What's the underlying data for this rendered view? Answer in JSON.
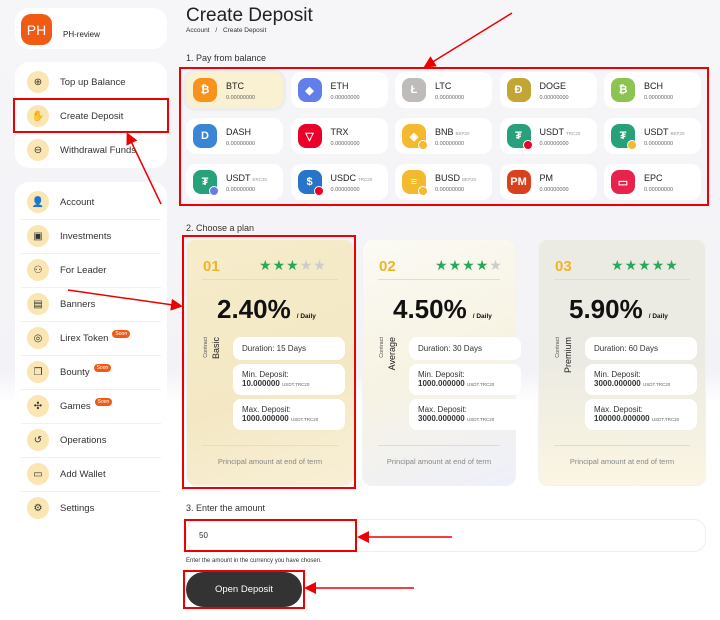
{
  "profile": {
    "initials": "PH",
    "name": "PH-review"
  },
  "sidebar": {
    "group1": [
      {
        "label": "Top up Balance",
        "icon": "plus-circle-icon"
      },
      {
        "label": "Create Deposit",
        "icon": "money-hand-icon"
      },
      {
        "label": "Withdrawal Funds",
        "icon": "minus-circle-icon"
      }
    ],
    "group2": [
      {
        "label": "Account",
        "icon": "user-icon"
      },
      {
        "label": "Investments",
        "icon": "briefcase-icon"
      },
      {
        "label": "For Leader",
        "icon": "team-icon"
      },
      {
        "label": "Banners",
        "icon": "image-icon"
      },
      {
        "label": "Lirex Token",
        "icon": "coin-icon",
        "badge": "Soon"
      },
      {
        "label": "Bounty",
        "icon": "gift-icon",
        "badge": "Soon"
      },
      {
        "label": "Games",
        "icon": "puzzle-icon",
        "badge": "Soon"
      },
      {
        "label": "Operations",
        "icon": "history-icon"
      },
      {
        "label": "Add Wallet",
        "icon": "wallet-icon"
      },
      {
        "label": "Settings",
        "icon": "gear-icon"
      }
    ]
  },
  "header": {
    "title": "Create Deposit",
    "breadcrumb": [
      "Account",
      "/",
      "Create Deposit"
    ]
  },
  "step1": {
    "label": "1. Pay from balance",
    "currencies": [
      {
        "name": "BTC",
        "net": "",
        "balance": "0.00000000",
        "color": "#f7931a",
        "glyph": "₿",
        "selected": true
      },
      {
        "name": "ETH",
        "net": "",
        "balance": "0.00000000",
        "color": "#627eea",
        "glyph": "◆"
      },
      {
        "name": "LTC",
        "net": "",
        "balance": "0.00000000",
        "color": "#bfbbbb",
        "glyph": "Ł"
      },
      {
        "name": "DOGE",
        "net": "",
        "balance": "0.00000000",
        "color": "#c2a633",
        "glyph": "Ð"
      },
      {
        "name": "BCH",
        "net": "",
        "balance": "0.00000000",
        "color": "#8dc351",
        "glyph": "₿"
      },
      {
        "name": "DASH",
        "net": "",
        "balance": "0.00000000",
        "color": "#3a85d6",
        "glyph": "D"
      },
      {
        "name": "TRX",
        "net": "",
        "balance": "0.00000000",
        "color": "#eb0029",
        "glyph": "▽"
      },
      {
        "name": "BNB",
        "net": "BEP20",
        "balance": "0.00000000",
        "color": "#f3ba2f",
        "glyph": "◈",
        "sub": "#f3ba2f"
      },
      {
        "name": "USDT",
        "net": "TRC20",
        "balance": "0.00000000",
        "color": "#26a17b",
        "glyph": "₮",
        "sub": "#eb0029"
      },
      {
        "name": "USDT",
        "net": "BEP20",
        "balance": "0.00000000",
        "color": "#26a17b",
        "glyph": "₮",
        "sub": "#f3ba2f"
      },
      {
        "name": "USDT",
        "net": "ERC20",
        "balance": "0.00000000",
        "color": "#26a17b",
        "glyph": "₮",
        "sub": "#627eea"
      },
      {
        "name": "USDC",
        "net": "TRC20",
        "balance": "0.00000000",
        "color": "#2775ca",
        "glyph": "$",
        "sub": "#eb0029"
      },
      {
        "name": "BUSD",
        "net": "BEP20",
        "balance": "0.00000000",
        "color": "#f3ba2f",
        "glyph": "≡",
        "sub": "#f3ba2f"
      },
      {
        "name": "PM",
        "net": "",
        "balance": "0.00000000",
        "color": "#d9411e",
        "glyph": "PM"
      },
      {
        "name": "EPC",
        "net": "",
        "balance": "0.00000000",
        "color": "#e8224a",
        "glyph": "▭"
      }
    ]
  },
  "step2": {
    "label": "2. Choose a plan",
    "plans": [
      {
        "num": "01",
        "stars": 3,
        "rate": "2.40%",
        "per": "/ Daily",
        "contract": "Contract",
        "name": "Basic",
        "duration": "Duration: 15 Days",
        "min_label": "Min. Deposit:",
        "min": "10.000000",
        "max_label": "Max. Deposit:",
        "max": "1000.000000",
        "unit": "USDT.TRC20",
        "footer": "Principal amount at end of term",
        "selected": true
      },
      {
        "num": "02",
        "stars": 4,
        "rate": "4.50%",
        "per": "/ Daily",
        "contract": "Contract",
        "name": "Average",
        "duration": "Duration: 30 Days",
        "min_label": "Min. Deposit:",
        "min": "1000.000000",
        "max_label": "Max. Deposit:",
        "max": "3000.000000",
        "unit": "USDT.TRC20",
        "footer": "Principal amount at end of term"
      },
      {
        "num": "03",
        "stars": 5,
        "rate": "5.90%",
        "per": "/ Daily",
        "contract": "Contract",
        "name": "Premium",
        "duration": "Duration: 60 Days",
        "min_label": "Min. Deposit:",
        "min": "3000.000000",
        "max_label": "Max. Deposit:",
        "max": "100000.000000",
        "unit": "USDT.TRC20",
        "footer": "Principal amount at end of term"
      }
    ]
  },
  "step3": {
    "label": "3. Enter the amount",
    "value": "50",
    "help": "Enter the amount in the currency you have chosen.",
    "button": "Open Deposit"
  },
  "colors": {
    "accent": "#f05a12",
    "star_on": "#27a95a",
    "star_off": "#cccccc",
    "annotation": "#ee0000"
  }
}
